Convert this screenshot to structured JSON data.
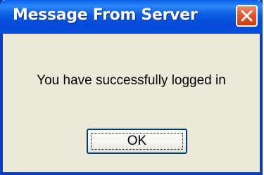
{
  "window": {
    "title": "Message From Server"
  },
  "message": {
    "text": "You have successfully logged in"
  },
  "buttons": {
    "ok_label": "OK",
    "close_icon": "close-icon"
  },
  "colors": {
    "titlebar": "#0a5be0",
    "frame": "#0a3cc6",
    "dialog_background": "#ece9d8",
    "close_button": "#e2562f"
  }
}
